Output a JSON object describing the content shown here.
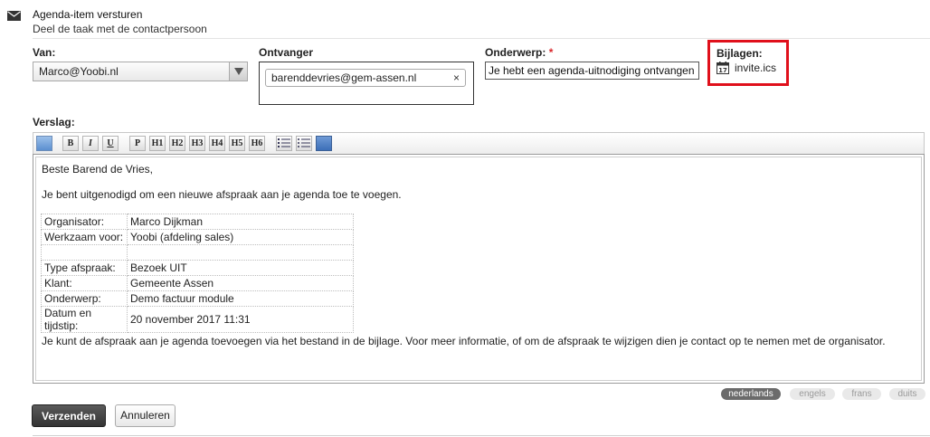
{
  "header": {
    "title": "Agenda-item versturen",
    "subtitle": "Deel de taak met de contactpersoon",
    "icon": "envelope-icon"
  },
  "van": {
    "label": "Van:",
    "value": "Marco@Yoobi.nl"
  },
  "ontvanger": {
    "label": "Ontvanger",
    "recipient": "barenddevries@gem-assen.nl",
    "remove": "×"
  },
  "onderwerp": {
    "label": "Onderwerp:",
    "required_mark": "*",
    "value": "Je hebt een agenda-uitnodiging ontvangen"
  },
  "bijlagen": {
    "label": "Bijlagen:",
    "file": "invite.ics",
    "icon": "calendar-icon"
  },
  "verslag": {
    "label": "Verslag:",
    "toolbar": [
      "html",
      "B",
      "I",
      "U",
      "P",
      "H1",
      "H2",
      "H3",
      "H4",
      "H5",
      "H6",
      "ordered-list",
      "unordered-list",
      "image"
    ],
    "greeting": "Beste Barend de Vries,",
    "intro": "Je bent uitgenodigd om een nieuwe afspraak aan je agenda toe te voegen.",
    "table": [
      [
        "Organisator:",
        "Marco Dijkman"
      ],
      [
        "Werkzaam voor:",
        "Yoobi (afdeling sales)"
      ],
      [
        "",
        ""
      ],
      [
        "Type afspraak:",
        "Bezoek UIT"
      ],
      [
        "Klant:",
        "Gemeente Assen"
      ],
      [
        "Onderwerp:",
        "Demo factuur module"
      ],
      [
        "Datum en tijdstip:",
        "20 november 2017 11:31"
      ]
    ],
    "closing": "Je kunt de afspraak aan je agenda toevoegen via het bestand in de bijlage. Voor meer informatie, of om de afspraak te wijzigen dien je contact op te nemen met de organisator."
  },
  "languages": [
    {
      "label": "nederlands",
      "active": true
    },
    {
      "label": "engels",
      "active": false
    },
    {
      "label": "frans",
      "active": false
    },
    {
      "label": "duits",
      "active": false
    }
  ],
  "buttons": {
    "send": "Verzenden",
    "cancel": "Annuleren"
  },
  "colors": {
    "highlight": "#e0101b",
    "primary_button": "#3f3f3f"
  }
}
